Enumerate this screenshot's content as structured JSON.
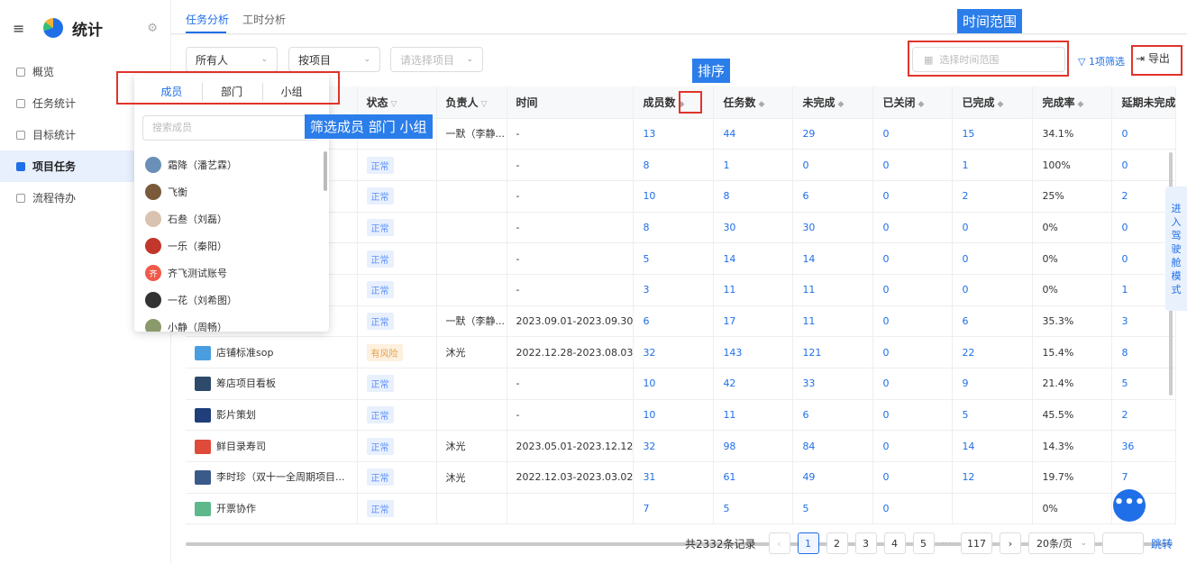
{
  "app": {
    "title": "统计"
  },
  "sidebar": {
    "items": [
      {
        "label": "概览"
      },
      {
        "label": "任务统计"
      },
      {
        "label": "目标统计"
      },
      {
        "label": "项目任务"
      },
      {
        "label": "流程待办"
      }
    ]
  },
  "tabs": [
    {
      "label": "任务分析"
    },
    {
      "label": "工时分析"
    }
  ],
  "filters": {
    "person": "所有人",
    "project_mode": "按项目",
    "project_placeholder": "请选择项目",
    "date_placeholder": "选择时间范围",
    "filter_count": "1项筛选",
    "export": "导出"
  },
  "table": {
    "headers": {
      "status": "状态",
      "owner": "负责人",
      "time": "时间",
      "members": "成员数",
      "tasks": "任务数",
      "unfinished": "未完成",
      "closed": "已关闭",
      "done": "已完成",
      "rate": "完成率",
      "overdue": "延期未完成"
    },
    "rows": [
      {
        "name": "",
        "status": "",
        "owner": "一默（李静...",
        "time": "-",
        "members": "13",
        "tasks": "44",
        "unfinished": "29",
        "closed": "0",
        "done": "15",
        "rate": "34.1%",
        "overdue": "0"
      },
      {
        "name": "",
        "status": "正常",
        "owner": "",
        "time": "-",
        "members": "8",
        "tasks": "1",
        "unfinished": "0",
        "closed": "0",
        "done": "1",
        "rate": "100%",
        "overdue": "0"
      },
      {
        "name": "",
        "status": "正常",
        "owner": "",
        "time": "-",
        "members": "10",
        "tasks": "8",
        "unfinished": "6",
        "closed": "0",
        "done": "2",
        "rate": "25%",
        "overdue": "2"
      },
      {
        "name": "",
        "status": "正常",
        "owner": "",
        "time": "-",
        "members": "8",
        "tasks": "30",
        "unfinished": "30",
        "closed": "0",
        "done": "0",
        "rate": "0%",
        "overdue": "0"
      },
      {
        "name": "",
        "status": "正常",
        "owner": "",
        "time": "-",
        "members": "5",
        "tasks": "14",
        "unfinished": "14",
        "closed": "0",
        "done": "0",
        "rate": "0%",
        "overdue": "0"
      },
      {
        "name": "",
        "status": "正常",
        "owner": "",
        "time": "-",
        "members": "3",
        "tasks": "11",
        "unfinished": "11",
        "closed": "0",
        "done": "0",
        "rate": "0%",
        "overdue": "1"
      },
      {
        "name": "",
        "status": "正常",
        "owner": "一默（李静...",
        "time": "2023.09.01-2023.09.30",
        "members": "6",
        "tasks": "17",
        "unfinished": "11",
        "closed": "0",
        "done": "6",
        "rate": "35.3%",
        "overdue": "3"
      },
      {
        "name": "店铺标准sop",
        "status": "有风险",
        "owner": "沐光",
        "time": "2022.12.28-2023.08.03",
        "members": "32",
        "tasks": "143",
        "unfinished": "121",
        "closed": "0",
        "done": "22",
        "rate": "15.4%",
        "overdue": "8"
      },
      {
        "name": "筹店项目看板",
        "status": "正常",
        "owner": "",
        "time": "-",
        "members": "10",
        "tasks": "42",
        "unfinished": "33",
        "closed": "0",
        "done": "9",
        "rate": "21.4%",
        "overdue": "5"
      },
      {
        "name": "影片策划",
        "status": "正常",
        "owner": "",
        "time": "-",
        "members": "10",
        "tasks": "11",
        "unfinished": "6",
        "closed": "0",
        "done": "5",
        "rate": "45.5%",
        "overdue": "2"
      },
      {
        "name": "鲜目录寿司",
        "status": "正常",
        "owner": "沐光",
        "time": "2023.05.01-2023.12.12",
        "members": "32",
        "tasks": "98",
        "unfinished": "84",
        "closed": "0",
        "done": "14",
        "rate": "14.3%",
        "overdue": "36"
      },
      {
        "name": "李时珍（双十一全周期项目...",
        "status": "正常",
        "owner": "沐光",
        "time": "2022.12.03-2023.03.02",
        "members": "31",
        "tasks": "61",
        "unfinished": "49",
        "closed": "0",
        "done": "12",
        "rate": "19.7%",
        "overdue": "7"
      },
      {
        "name": "开票协作",
        "status": "正常",
        "owner": "",
        "time": "",
        "members": "7",
        "tasks": "5",
        "unfinished": "5",
        "closed": "0",
        "done": "",
        "rate": "0%",
        "overdue": ""
      }
    ]
  },
  "pagination": {
    "total": "共2332条记录",
    "pages": [
      "1",
      "2",
      "3",
      "4",
      "5"
    ],
    "ellipsis": "···",
    "last": "117",
    "page_size": "20条/页",
    "jump": "跳转"
  },
  "dropdown": {
    "tabs": [
      "成员",
      "部门",
      "小组"
    ],
    "search_placeholder": "搜索成员",
    "members": [
      {
        "name": "霜降（潘艺霖）",
        "color": "#6a8fb8"
      },
      {
        "name": "飞衡",
        "color": "#7a5a3a"
      },
      {
        "name": "石叁（刘磊）",
        "color": "#d9c3b0"
      },
      {
        "name": "一乐（秦阳）",
        "color": "#c2362b"
      },
      {
        "name": "齐飞测试账号",
        "color": "#f05a4a",
        "initial": "齐"
      },
      {
        "name": "一花（刘希图）",
        "color": "#333333"
      },
      {
        "name": "小静（周畅）",
        "color": "#8a9a6a"
      }
    ]
  },
  "annotations": {
    "time_range": "时间范围",
    "sort": "排序",
    "filter_members": "筛选成员 部门 小组"
  },
  "side_tab": "进入驾驶舱模式",
  "fab": "•••"
}
